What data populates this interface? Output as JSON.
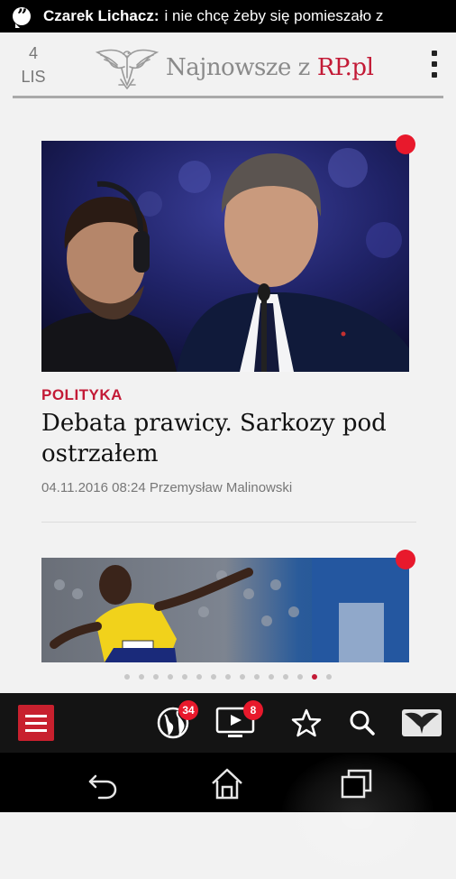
{
  "status_bar": {
    "sender": "Czarek Lichacz:",
    "message": "i nie chcę żeby się pomieszało z"
  },
  "header": {
    "date_day": "4",
    "date_month": "LIS",
    "logo_prefix": "Najnowsze z",
    "logo_brand": "RP.pl",
    "menu_icon": "overflow-menu-icon"
  },
  "articles": [
    {
      "category": "POLITYKA",
      "title": "Debata prawicy. Sarkozy pod ostrzałem",
      "meta": "04.11.2016 08:24 Przemysław Malinowski",
      "unread": true
    },
    {
      "unread": true
    }
  ],
  "pager": {
    "total": 15,
    "active_index": 13
  },
  "toolbar": {
    "items": [
      {
        "icon": "hamburger-menu-icon"
      },
      {
        "icon": "globe-icon",
        "badge": "34"
      },
      {
        "icon": "video-tv-icon",
        "badge": "8"
      },
      {
        "icon": "star-icon"
      },
      {
        "icon": "search-icon"
      },
      {
        "icon": "rp-eagle-icon"
      }
    ]
  },
  "nav_bar": {
    "items": [
      {
        "icon": "back-icon"
      },
      {
        "icon": "home-icon"
      },
      {
        "icon": "recent-apps-icon"
      }
    ]
  },
  "colors": {
    "accent": "#c31a36",
    "unread_dot": "#e8192c",
    "toolbar_bg": "#141414"
  }
}
